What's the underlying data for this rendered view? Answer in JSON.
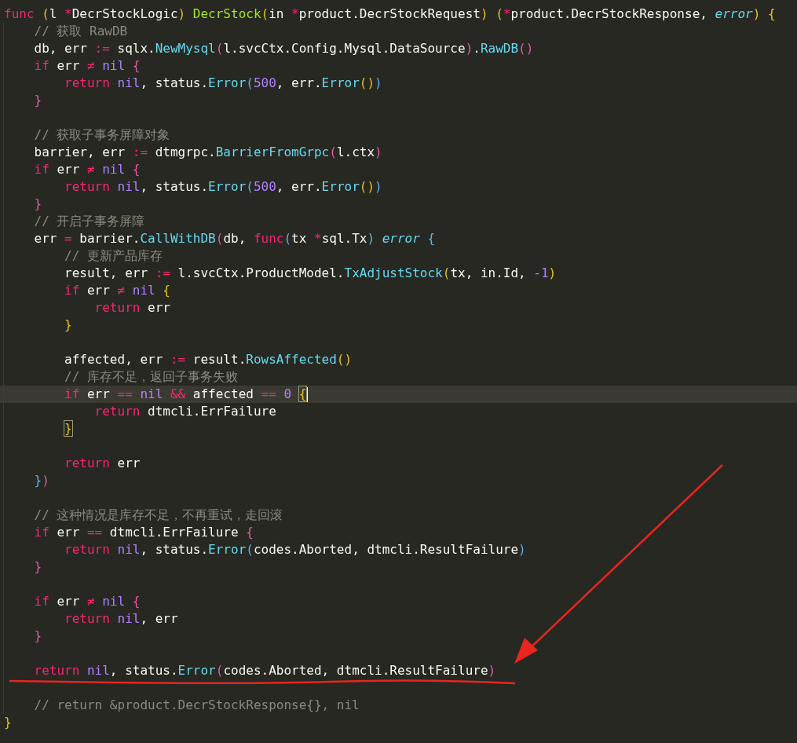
{
  "editor": {
    "lines": [
      {
        "current": false,
        "tokens": [
          {
            "kind": "keyword",
            "text": "func"
          },
          {
            "kind": "b1",
            "text": " ("
          },
          {
            "kind": "plain",
            "text": "l"
          },
          {
            "kind": "op",
            "text": " *"
          },
          {
            "kind": "plain",
            "text": "DecrStockLogic"
          },
          {
            "kind": "b1",
            "text": ")"
          },
          {
            "kind": "fn",
            "text": " DecrStock"
          },
          {
            "kind": "b1",
            "text": "("
          },
          {
            "kind": "plain",
            "text": "in"
          },
          {
            "kind": "op",
            "text": " *"
          },
          {
            "kind": "plain",
            "text": "product.DecrStockRequest"
          },
          {
            "kind": "b1",
            "text": ")"
          },
          {
            "kind": "b1",
            "text": " ("
          },
          {
            "kind": "op",
            "text": "*"
          },
          {
            "kind": "plain",
            "text": "product.DecrStockResponse,"
          },
          {
            "kind": "type",
            "text": " error"
          },
          {
            "kind": "b1",
            "text": ")"
          },
          {
            "kind": "b1",
            "text": " {"
          }
        ]
      },
      {
        "current": false,
        "tokens": [
          {
            "kind": "comment",
            "text": "    // 获取 RawDB"
          }
        ]
      },
      {
        "current": false,
        "tokens": [
          {
            "kind": "plain",
            "text": "    db, err"
          },
          {
            "kind": "op",
            "text": " :="
          },
          {
            "kind": "plain",
            "text": " sqlx."
          },
          {
            "kind": "call",
            "text": "NewMysql"
          },
          {
            "kind": "b2",
            "text": "("
          },
          {
            "kind": "plain",
            "text": "l.svcCtx.Config.Mysql.DataSource"
          },
          {
            "kind": "b2",
            "text": ")"
          },
          {
            "kind": "plain",
            "text": "."
          },
          {
            "kind": "call",
            "text": "RawDB"
          },
          {
            "kind": "b2",
            "text": "()"
          }
        ]
      },
      {
        "current": false,
        "tokens": [
          {
            "kind": "keyword",
            "text": "    if"
          },
          {
            "kind": "plain",
            "text": " err"
          },
          {
            "kind": "op",
            "text": " ≠"
          },
          {
            "kind": "const",
            "text": " nil"
          },
          {
            "kind": "b2",
            "text": " {"
          }
        ]
      },
      {
        "current": false,
        "tokens": [
          {
            "kind": "keyword",
            "text": "        return"
          },
          {
            "kind": "const",
            "text": " nil"
          },
          {
            "kind": "plain",
            "text": ", status."
          },
          {
            "kind": "call",
            "text": "Error"
          },
          {
            "kind": "b3",
            "text": "("
          },
          {
            "kind": "const",
            "text": "500"
          },
          {
            "kind": "plain",
            "text": ", err."
          },
          {
            "kind": "call",
            "text": "Error"
          },
          {
            "kind": "b1",
            "text": "()"
          },
          {
            "kind": "b3",
            "text": ")"
          }
        ]
      },
      {
        "current": false,
        "tokens": [
          {
            "kind": "b2",
            "text": "    }"
          }
        ]
      },
      {
        "current": false
      },
      {
        "current": false,
        "tokens": [
          {
            "kind": "comment",
            "text": "    // 获取子事务屏障对象"
          }
        ]
      },
      {
        "current": false,
        "tokens": [
          {
            "kind": "plain",
            "text": "    barrier, err"
          },
          {
            "kind": "op",
            "text": " :="
          },
          {
            "kind": "plain",
            "text": " dtmgrpc."
          },
          {
            "kind": "call",
            "text": "BarrierFromGrpc"
          },
          {
            "kind": "b2",
            "text": "("
          },
          {
            "kind": "plain",
            "text": "l.ctx"
          },
          {
            "kind": "b2",
            "text": ")"
          }
        ]
      },
      {
        "current": false,
        "tokens": [
          {
            "kind": "keyword",
            "text": "    if"
          },
          {
            "kind": "plain",
            "text": " err"
          },
          {
            "kind": "op",
            "text": " ≠"
          },
          {
            "kind": "const",
            "text": " nil"
          },
          {
            "kind": "b2",
            "text": " {"
          }
        ]
      },
      {
        "current": false,
        "tokens": [
          {
            "kind": "keyword",
            "text": "        return"
          },
          {
            "kind": "const",
            "text": " nil"
          },
          {
            "kind": "plain",
            "text": ", status."
          },
          {
            "kind": "call",
            "text": "Error"
          },
          {
            "kind": "b3",
            "text": "("
          },
          {
            "kind": "const",
            "text": "500"
          },
          {
            "kind": "plain",
            "text": ", err."
          },
          {
            "kind": "call",
            "text": "Error"
          },
          {
            "kind": "b1",
            "text": "()"
          },
          {
            "kind": "b3",
            "text": ")"
          }
        ]
      },
      {
        "current": false,
        "tokens": [
          {
            "kind": "b2",
            "text": "    }"
          }
        ]
      },
      {
        "current": false,
        "tokens": [
          {
            "kind": "comment",
            "text": "    // 开启子事务屏障"
          }
        ]
      },
      {
        "current": false,
        "tokens": [
          {
            "kind": "plain",
            "text": "    err"
          },
          {
            "kind": "op",
            "text": " ="
          },
          {
            "kind": "plain",
            "text": " barrier."
          },
          {
            "kind": "call",
            "text": "CallWithDB"
          },
          {
            "kind": "b2",
            "text": "("
          },
          {
            "kind": "plain",
            "text": "db,"
          },
          {
            "kind": "keyword",
            "text": " func"
          },
          {
            "kind": "b3",
            "text": "("
          },
          {
            "kind": "plain",
            "text": "tx"
          },
          {
            "kind": "op",
            "text": " *"
          },
          {
            "kind": "plain",
            "text": "sql.Tx"
          },
          {
            "kind": "b3",
            "text": ")"
          },
          {
            "kind": "type",
            "text": " error"
          },
          {
            "kind": "b3",
            "text": " {"
          }
        ]
      },
      {
        "current": false,
        "tokens": [
          {
            "kind": "comment",
            "text": "        // 更新产品库存"
          }
        ]
      },
      {
        "current": false,
        "tokens": [
          {
            "kind": "plain",
            "text": "        result, err"
          },
          {
            "kind": "op",
            "text": " :="
          },
          {
            "kind": "plain",
            "text": " l.svcCtx.ProductModel."
          },
          {
            "kind": "call",
            "text": "TxAdjustStock"
          },
          {
            "kind": "b1",
            "text": "("
          },
          {
            "kind": "plain",
            "text": "tx, in.Id,"
          },
          {
            "kind": "const",
            "text": " -1"
          },
          {
            "kind": "b1",
            "text": ")"
          }
        ]
      },
      {
        "current": false,
        "tokens": [
          {
            "kind": "keyword",
            "text": "        if"
          },
          {
            "kind": "plain",
            "text": " err"
          },
          {
            "kind": "op",
            "text": " ≠"
          },
          {
            "kind": "const",
            "text": " nil"
          },
          {
            "kind": "b1",
            "text": " {"
          }
        ]
      },
      {
        "current": false,
        "tokens": [
          {
            "kind": "keyword",
            "text": "            return"
          },
          {
            "kind": "plain",
            "text": " err"
          }
        ]
      },
      {
        "current": false,
        "tokens": [
          {
            "kind": "b1",
            "text": "        }"
          }
        ]
      },
      {
        "current": false
      },
      {
        "current": false,
        "tokens": [
          {
            "kind": "plain",
            "text": "        affected, err"
          },
          {
            "kind": "op",
            "text": " :="
          },
          {
            "kind": "plain",
            "text": " result."
          },
          {
            "kind": "call",
            "text": "RowsAffected"
          },
          {
            "kind": "b1",
            "text": "()"
          }
        ]
      },
      {
        "current": false,
        "tokens": [
          {
            "kind": "comment",
            "text": "        // 库存不足，返回子事务失败"
          }
        ]
      },
      {
        "current": true,
        "tokens": [
          {
            "kind": "keyword",
            "text": "        if"
          },
          {
            "kind": "plain",
            "text": " err"
          },
          {
            "kind": "op",
            "text": " =="
          },
          {
            "kind": "const",
            "text": " nil"
          },
          {
            "kind": "op",
            "text": " &&"
          },
          {
            "kind": "plain",
            "text": " affected"
          },
          {
            "kind": "op",
            "text": " =="
          },
          {
            "kind": "const",
            "text": " 0"
          },
          {
            "kind": "match",
            "text": " {"
          }
        ]
      },
      {
        "current": false,
        "tokens": [
          {
            "kind": "keyword",
            "text": "            return"
          },
          {
            "kind": "plain",
            "text": " dtmcli.ErrFailure"
          }
        ]
      },
      {
        "current": false,
        "tokens": [
          {
            "kind": "match",
            "text": "        }"
          }
        ]
      },
      {
        "current": false
      },
      {
        "current": false,
        "tokens": [
          {
            "kind": "keyword",
            "text": "        return"
          },
          {
            "kind": "plain",
            "text": " err"
          }
        ]
      },
      {
        "current": false,
        "tokens": [
          {
            "kind": "b3",
            "text": "    }"
          },
          {
            "kind": "b2",
            "text": ")"
          }
        ]
      },
      {
        "current": false
      },
      {
        "current": false,
        "tokens": [
          {
            "kind": "comment",
            "text": "    // 这种情况是库存不足，不再重试，走回滚"
          }
        ]
      },
      {
        "current": false,
        "tokens": [
          {
            "kind": "keyword",
            "text": "    if"
          },
          {
            "kind": "plain",
            "text": " err"
          },
          {
            "kind": "op",
            "text": " =="
          },
          {
            "kind": "plain",
            "text": " dtmcli.ErrFailure"
          },
          {
            "kind": "b2",
            "text": " {"
          }
        ]
      },
      {
        "current": false,
        "tokens": [
          {
            "kind": "keyword",
            "text": "        return"
          },
          {
            "kind": "const",
            "text": " nil"
          },
          {
            "kind": "plain",
            "text": ", status."
          },
          {
            "kind": "call",
            "text": "Error"
          },
          {
            "kind": "b3",
            "text": "("
          },
          {
            "kind": "plain",
            "text": "codes.Aborted, dtmcli.ResultFailure"
          },
          {
            "kind": "b3",
            "text": ")"
          }
        ]
      },
      {
        "current": false,
        "tokens": [
          {
            "kind": "b2",
            "text": "    }"
          }
        ]
      },
      {
        "current": false
      },
      {
        "current": false,
        "tokens": [
          {
            "kind": "keyword",
            "text": "    if"
          },
          {
            "kind": "plain",
            "text": " err"
          },
          {
            "kind": "op",
            "text": " ≠"
          },
          {
            "kind": "const",
            "text": " nil"
          },
          {
            "kind": "b2",
            "text": " {"
          }
        ]
      },
      {
        "current": false,
        "tokens": [
          {
            "kind": "keyword",
            "text": "        return"
          },
          {
            "kind": "const",
            "text": " nil"
          },
          {
            "kind": "plain",
            "text": ", err"
          }
        ]
      },
      {
        "current": false,
        "tokens": [
          {
            "kind": "b2",
            "text": "    }"
          }
        ]
      },
      {
        "current": false
      },
      {
        "current": false,
        "tokens": [
          {
            "kind": "keyword",
            "text": "    return"
          },
          {
            "kind": "const",
            "text": " nil"
          },
          {
            "kind": "plain",
            "text": ", status."
          },
          {
            "kind": "call",
            "text": "Error"
          },
          {
            "kind": "b2",
            "text": "("
          },
          {
            "kind": "plain",
            "text": "codes.Aborted, dtmcli.ResultFailure"
          },
          {
            "kind": "b2",
            "text": ")"
          }
        ]
      },
      {
        "current": false
      },
      {
        "current": false,
        "tokens": [
          {
            "kind": "comment",
            "text": "    // return &product.DecrStockResponse{}, nil"
          }
        ]
      },
      {
        "current": false,
        "tokens": [
          {
            "kind": "b1",
            "text": "}"
          }
        ]
      }
    ]
  }
}
